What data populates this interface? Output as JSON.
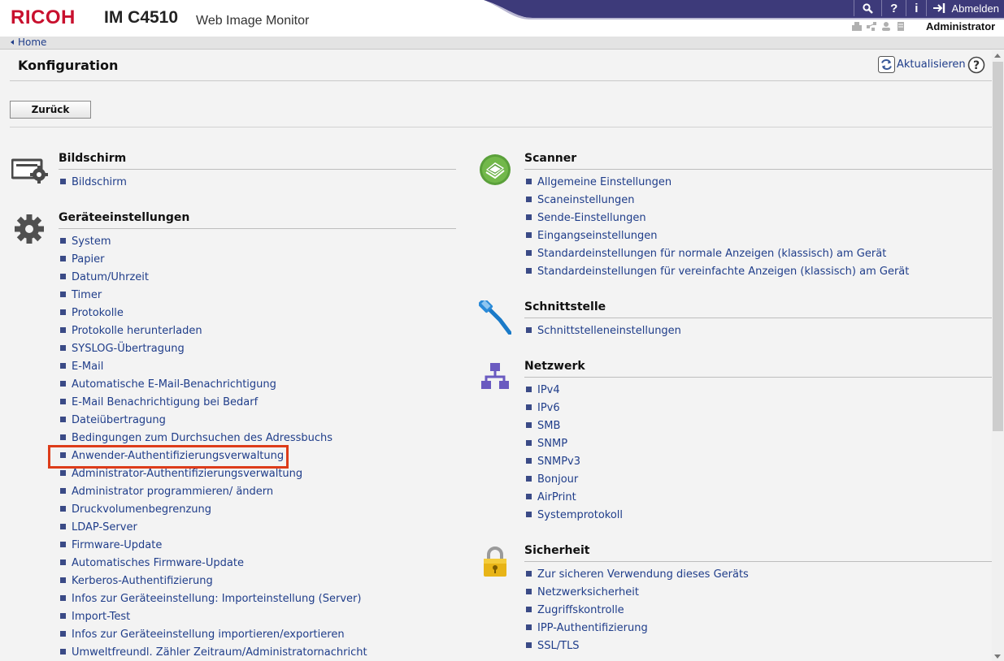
{
  "header": {
    "brand": "RICOH",
    "model": "IM C4510",
    "product": "Web Image Monitor",
    "user": "Administrator",
    "logout_label": "Abmelden",
    "search_glyph": "🔍",
    "help_glyph": "?",
    "info_glyph": "i"
  },
  "breadcrumb": {
    "home": "Home"
  },
  "page": {
    "title": "Konfiguration",
    "refresh_label": "Aktualisieren",
    "back_label": "Zurück"
  },
  "left": [
    {
      "title": "Bildschirm",
      "items": [
        "Bildschirm"
      ]
    },
    {
      "title": "Geräteeinstellungen",
      "items": [
        "System",
        "Papier",
        "Datum/Uhrzeit",
        "Timer",
        "Protokolle",
        "Protokolle herunterladen",
        "SYSLOG-Übertragung",
        "E-Mail",
        "Automatische E-Mail-Benachrichtigung",
        "E-Mail Benachrichtigung bei Bedarf",
        "Dateiübertragung",
        "Bedingungen zum Durchsuchen des Adressbuchs",
        "Anwender-Authentifizierungsverwaltung",
        "Administrator-Authentifizierungsverwaltung",
        "Administrator programmieren/ ändern",
        "Druckvolumenbegrenzung",
        "LDAP-Server",
        "Firmware-Update",
        "Automatisches Firmware-Update",
        "Kerberos-Authentifizierung",
        "Infos zur Geräteeinstellung: Importeinstellung (Server)",
        "Import-Test",
        "Infos zur Geräteeinstellung importieren/exportieren",
        "Umweltfreundl. Zähler Zeitraum/Administratornachricht"
      ]
    }
  ],
  "right": [
    {
      "title": "Scanner",
      "items": [
        "Allgemeine Einstellungen",
        "Scaneinstellungen",
        "Sende-Einstellungen",
        "Eingangseinstellungen",
        "Standardeinstellungen für normale Anzeigen (klassisch) am Gerät",
        "Standardeinstellungen für vereinfachte Anzeigen (klassisch) am Gerät"
      ]
    },
    {
      "title": "Schnittstelle",
      "items": [
        "Schnittstelleneinstellungen"
      ]
    },
    {
      "title": "Netzwerk",
      "items": [
        "IPv4",
        "IPv6",
        "SMB",
        "SNMP",
        "SNMPv3",
        "Bonjour",
        "AirPrint",
        "Systemprotokoll"
      ]
    },
    {
      "title": "Sicherheit",
      "items": [
        "Zur sicheren Verwendung dieses Geräts",
        "Netzwerksicherheit",
        "Zugriffskontrolle",
        "IPP-Authentifizierung",
        "SSL/TLS"
      ]
    }
  ],
  "colors": {
    "brand_red": "#c8102e",
    "link_blue": "#1f3d8a",
    "header_purple": "#3d3a7a",
    "highlight": "#dd3c1a"
  }
}
